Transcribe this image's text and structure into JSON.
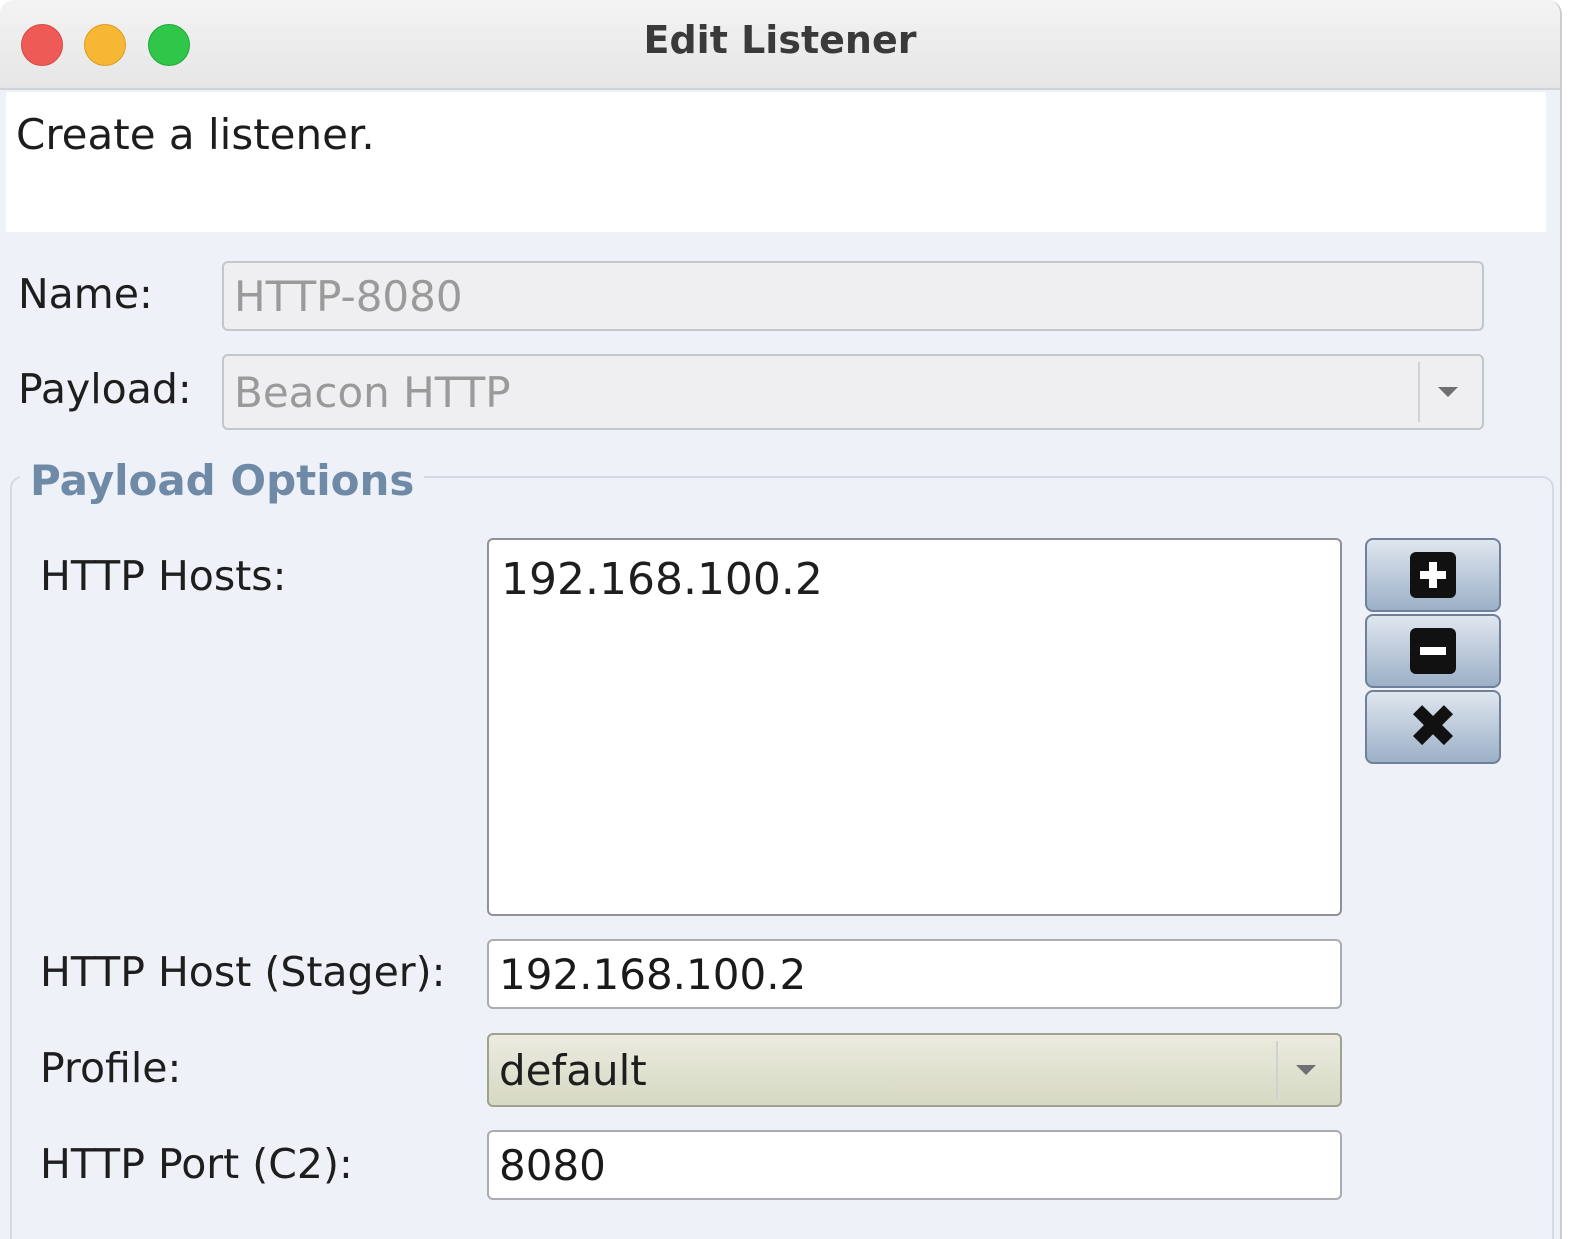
{
  "window": {
    "title": "Edit Listener",
    "description": "Create a listener."
  },
  "form": {
    "name_label": "Name:",
    "name_value": "HTTP-8080",
    "payload_label": "Payload:",
    "payload_value": "Beacon HTTP"
  },
  "payload_options": {
    "group_title": "Payload Options",
    "hosts_label": "HTTP Hosts:",
    "hosts": [
      "192.168.100.2"
    ],
    "stager_label": "HTTP Host (Stager):",
    "stager_value": "192.168.100.2",
    "profile_label": "Profile:",
    "profile_value": "default",
    "port_label": "HTTP Port (C2):",
    "port_value": "8080"
  },
  "icons": {
    "add": "plus-icon",
    "remove": "minus-icon",
    "clear": "x-icon"
  }
}
